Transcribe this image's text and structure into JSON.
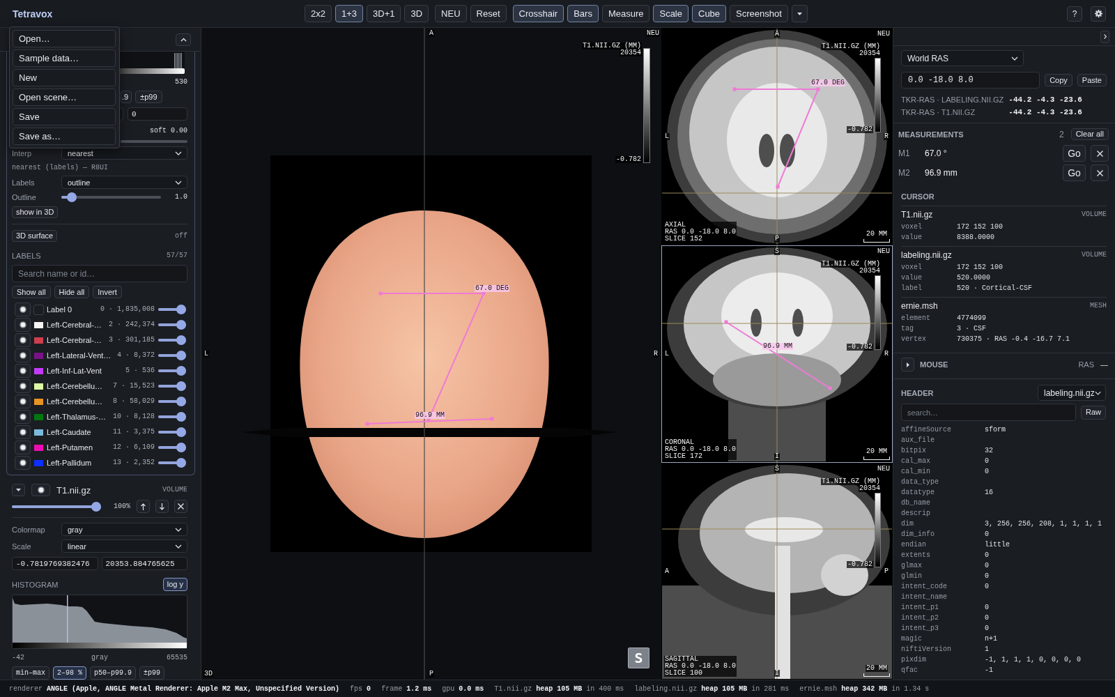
{
  "app": {
    "title": "Tetravox"
  },
  "toolbar": {
    "layouts": [
      {
        "label": "2x2",
        "selected": false
      },
      {
        "label": "1+3",
        "selected": true
      },
      {
        "label": "3D+1",
        "selected": false
      },
      {
        "label": "3D",
        "selected": false
      }
    ],
    "actions": [
      "NEU",
      "Reset"
    ],
    "toggles": [
      {
        "label": "Crosshair",
        "on": true
      },
      {
        "label": "Bars",
        "on": true
      },
      {
        "label": "Measure",
        "on": false
      },
      {
        "label": "Scale",
        "on": true
      },
      {
        "label": "Cube",
        "on": true
      }
    ],
    "screenshot": "Screenshot",
    "help": "?"
  },
  "file_menu": [
    "Open…",
    "Sample data…",
    "New",
    "Open scene…",
    "Save",
    "Save as…"
  ],
  "label_layer": {
    "histogram_max": "530",
    "range_buttons": [
      ".9",
      "±p99"
    ],
    "threshold": "0",
    "soft": "soft 0.00",
    "interp": {
      "label": "Interp",
      "value": "nearest"
    },
    "interp_note": "nearest (labels) — R8UI",
    "labels_mode": {
      "label": "Labels",
      "value": "outline"
    },
    "outline": {
      "label": "Outline",
      "level": 0.06,
      "reading": "1.0"
    },
    "show_in_3d": "show in 3D",
    "surface": {
      "button": "3D surface",
      "state": "off"
    },
    "labels": {
      "title": "LABELS",
      "count": "57/57",
      "search_placeholder": "Search name or id…",
      "actions": [
        "Show all",
        "Hide all",
        "Invert"
      ],
      "rows": [
        {
          "name": "Label 0",
          "info": "0 · 1,835,008",
          "visible": true,
          "level": 1
        },
        {
          "name": "Left-Cerebral-…",
          "info": "2 · 242,374",
          "color": "#f5f5f5",
          "visible": true,
          "level": 1
        },
        {
          "name": "Left-Cerebral-…",
          "info": "3 · 301,185",
          "color": "#cd3e4e",
          "visible": true,
          "level": 1
        },
        {
          "name": "Left-Lateral-Vent…",
          "info": "4 · 8,372",
          "color": "#781286",
          "visible": true,
          "level": 1
        },
        {
          "name": "Left-Inf-Lat-Vent",
          "info": "5 · 536",
          "color": "#c43afa",
          "visible": true,
          "level": 1
        },
        {
          "name": "Left-Cerebellu…",
          "info": "7 · 15,523",
          "color": "#dcf8a4",
          "visible": true,
          "level": 1
        },
        {
          "name": "Left-Cerebellu…",
          "info": "8 · 58,029",
          "color": "#e69422",
          "visible": true,
          "level": 1
        },
        {
          "name": "Left-Thalamus-…",
          "info": "10 · 8,128",
          "color": "#00760e",
          "visible": true,
          "level": 1
        },
        {
          "name": "Left-Caudate",
          "info": "11 · 3,375",
          "color": "#7abadc",
          "visible": true,
          "level": 1
        },
        {
          "name": "Left-Putamen",
          "info": "12 · 6,109",
          "color": "#ec0db0",
          "visible": true,
          "level": 1
        },
        {
          "name": "Left-Pallidum",
          "info": "13 · 2,352",
          "color": "#0c30ff",
          "visible": true,
          "level": 1
        }
      ]
    }
  },
  "volume_layer": {
    "expanded": true,
    "visible": true,
    "name": "T1.nii.gz",
    "type": "VOLUME",
    "opacity": {
      "level": 1,
      "reading": "100%"
    },
    "colormap": {
      "label": "Colormap",
      "value": "gray"
    },
    "scale": {
      "label": "Scale",
      "value": "linear"
    },
    "min": "-0.7819769382476",
    "max": "20353.884765625",
    "histogram": {
      "title": "HISTOGRAM",
      "log_y": {
        "label": "log y",
        "on": true
      },
      "min": "-42",
      "colormap": "gray",
      "max": "65535"
    },
    "presets": [
      {
        "label": "min–max",
        "selected": false
      },
      {
        "label": "2–98 %",
        "selected": true
      },
      {
        "label": "p50–p99.9",
        "selected": false
      },
      {
        "label": "±p99",
        "selected": false
      }
    ]
  },
  "view_3d": {
    "label": "3D",
    "orientation": {
      "top": "A",
      "bottom": "P",
      "left": "L",
      "right": "R"
    },
    "neu": "NEU",
    "colorbar": {
      "title": "T1.NII.GZ (MM)",
      "max": "20354",
      "min": "-0.782"
    },
    "measurements": [
      {
        "kind": "angle",
        "label": "67.0 DEG"
      },
      {
        "kind": "distance",
        "label": "96.9 MM"
      }
    ],
    "orientation_button": "S"
  },
  "slice_views": [
    {
      "kind": "axial",
      "selected": false,
      "orientation": {
        "top": "A",
        "bottom": "P",
        "left": "L",
        "right": "R"
      },
      "neu": "NEU",
      "colorbar": {
        "title": "T1.NII.GZ (MM)",
        "max": "20354",
        "min": "-0.782"
      },
      "plane": "AXIAL",
      "position": "RAS 0.0 -18.0 8.0",
      "slice": "SLICE 152",
      "scale": "20 MM",
      "measurements": [
        {
          "kind": "angle",
          "label": "67.0 DEG"
        }
      ]
    },
    {
      "kind": "coronal",
      "selected": true,
      "orientation": {
        "top": "S",
        "bottom": "I",
        "left": "L",
        "right": "R"
      },
      "neu": "NEU",
      "colorbar": {
        "title": "T1.NII.GZ (MM)",
        "max": "20354",
        "min": "-0.782"
      },
      "plane": "CORONAL",
      "position": "RAS 0.0 -18.0 8.0",
      "slice": "SLICE 172",
      "scale": "20 MM",
      "measurements": [
        {
          "kind": "distance",
          "label": "96.9 MM"
        }
      ]
    },
    {
      "kind": "sagittal",
      "selected": false,
      "orientation": {
        "top": "S",
        "bottom": "I",
        "left": "A",
        "right": "P"
      },
      "neu": "NEU",
      "colorbar": {
        "title": "T1.NII.GZ (MM)",
        "max": "20354",
        "min": "-0.782"
      },
      "plane": "SAGITTAL",
      "position": "RAS 0.0 -18.0 8.0",
      "slice": "SLICE 100",
      "scale": "20 MM"
    }
  ],
  "location": {
    "space": "World RAS",
    "value": "0.0 -18.0 8.0",
    "copy": "Copy",
    "paste": "Paste",
    "transforms": [
      {
        "label": "TKR-RAS · LABELING.NII.GZ",
        "value": "-44.2 -4.3 -23.6"
      },
      {
        "label": "TKR-RAS · T1.NII.GZ",
        "value": "-44.2 -4.3 -23.6"
      }
    ]
  },
  "measurements": {
    "title": "MEASUREMENTS",
    "count": "2",
    "clear": "Clear all",
    "items": [
      {
        "name": "M1",
        "value": "67.0 °",
        "go": "Go"
      },
      {
        "name": "M2",
        "value": "96.9 mm",
        "go": "Go"
      }
    ]
  },
  "cursor": {
    "title": "CURSOR",
    "layers": [
      {
        "name": "T1.nii.gz",
        "type": "VOLUME",
        "fields": [
          {
            "key": "voxel",
            "value": "172 152 100"
          },
          {
            "key": "value",
            "value": "8388.0000"
          }
        ]
      },
      {
        "name": "labeling.nii.gz",
        "type": "VOLUME",
        "fields": [
          {
            "key": "voxel",
            "value": "172 152 100"
          },
          {
            "key": "value",
            "value": "520.0000"
          },
          {
            "key": "label",
            "value": "520 · Cortical-CSF"
          }
        ]
      },
      {
        "name": "ernie.msh",
        "type": "MESH",
        "fields": [
          {
            "key": "element",
            "value": "4774099"
          },
          {
            "key": "tag",
            "value": "3 · CSF"
          },
          {
            "key": "vertex",
            "value": "730375 · RAS -0.4 -16.7 7.1"
          }
        ]
      }
    ]
  },
  "mouse": {
    "title": "MOUSE",
    "expanded": false,
    "space": "RAS",
    "value": "—"
  },
  "header": {
    "title": "HEADER",
    "file": "labeling.nii.gz",
    "search_placeholder": "search…",
    "raw": "Raw",
    "rows": [
      {
        "key": "affineSource",
        "value": "sform"
      },
      {
        "key": "aux_file"
      },
      {
        "key": "bitpix",
        "value": "32"
      },
      {
        "key": "cal_max",
        "value": "0"
      },
      {
        "key": "cal_min",
        "value": "0"
      },
      {
        "key": "data_type"
      },
      {
        "key": "datatype",
        "value": "16"
      },
      {
        "key": "db_name"
      },
      {
        "key": "descrip"
      },
      {
        "key": "dim",
        "value": "3, 256, 256, 208, 1, 1, 1, 1"
      },
      {
        "key": "dim_info",
        "value": "0"
      },
      {
        "key": "endian",
        "value": "little"
      },
      {
        "key": "extents",
        "value": "0"
      },
      {
        "key": "glmax",
        "value": "0"
      },
      {
        "key": "glmin",
        "value": "0"
      },
      {
        "key": "intent_code",
        "value": "0"
      },
      {
        "key": "intent_name"
      },
      {
        "key": "intent_p1",
        "value": "0"
      },
      {
        "key": "intent_p2",
        "value": "0"
      },
      {
        "key": "intent_p3",
        "value": "0"
      },
      {
        "key": "magic",
        "value": "n+1"
      },
      {
        "key": "niftiVersion",
        "value": "1"
      },
      {
        "key": "pixdim",
        "value": "-1, 1, 1, 1, 0, 0, 0, 0"
      },
      {
        "key": "qfac",
        "value": "-1"
      }
    ]
  },
  "status_bar": [
    "renderer **ANGLE (Apple, ANGLE Metal Renderer: Apple M2 Max, Unspecified Version)**",
    "fps **0**",
    "frame **1.2 ms**",
    "gpu **0.0 ms**",
    "T1.nii.gz **heap 105 MB** in 400 ms",
    "labeling.nii.gz **heap 105 MB** in 281 ms",
    "ernie.msh **heap 342 MB** in 1.34 s"
  ]
}
